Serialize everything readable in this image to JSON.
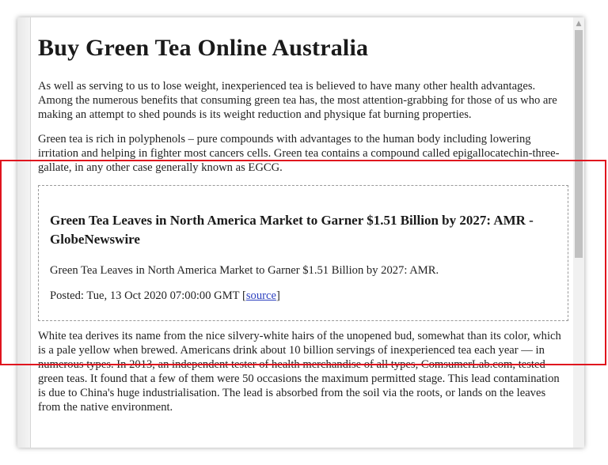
{
  "page": {
    "title": "Buy Green Tea Online Australia",
    "paragraphs": [
      "As well as serving to us to lose weight, inexperienced tea is believed to have many other health advantages. Among the numerous benefits that consuming green tea has, the most attention-grabbing for those of us who are making an attempt to shed pounds is its weight reduction and physique fat burning properties.",
      "Green tea is rich in polyphenols – pure compounds with advantages to the human body including lowering irritation and helping in fighter most cancers cells. Green tea contains a compound called epigallocatechin-three-gallate, in any other case generally known as EGCG."
    ],
    "news": {
      "title": "Green Tea Leaves in North America Market to Garner $1.51 Billion by 2027: AMR - GlobeNewswire",
      "summary": "Green Tea Leaves in North America Market to Garner $1.51 Billion by 2027: AMR.",
      "posted_prefix": "Posted: Tue, 13 Oct 2020 07:00:00 GMT [",
      "source_label": "source",
      "posted_suffix": "]"
    },
    "after_paragraph": "White tea derives its name from the nice silvery-white hairs of the unopened bud, somewhat than its color, which is a pale yellow when brewed. Americans drink about 10 billion servings of inexperienced tea each year — in numerous types. In 2013, an independent tester of health merchandise of all types, ComsumerLab.com, tested green teas. It found that a few of them were 50 occasions the maximum permitted stage. This lead contamination is due to China's huge industrialisation. The lead is absorbed from the soil via the roots, or lands on the leaves from the native environment."
  },
  "icons": {
    "scroll_up": "▲"
  },
  "colors": {
    "highlight": "#e0141e",
    "link": "#2b3fbf"
  }
}
